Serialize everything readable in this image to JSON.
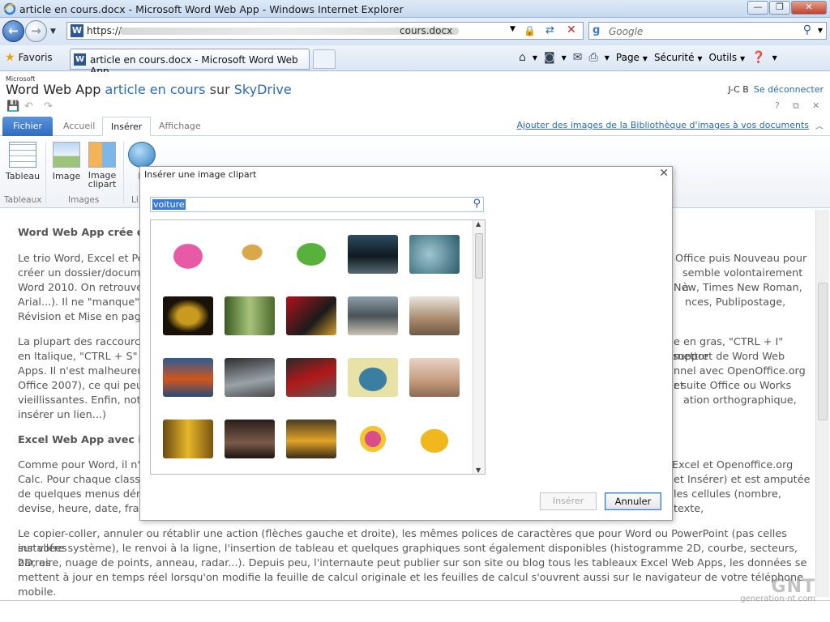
{
  "window": {
    "title": "article en cours.docx - Microsoft Word Web App - Windows Internet Explorer",
    "controls": [
      "—",
      "❐",
      "✕"
    ]
  },
  "address_bar": {
    "url_prefix": "https://",
    "url_suffix": "cours.docx",
    "search_placeholder": "Google"
  },
  "favorites_bar": {
    "favorites_label": "Favoris",
    "tab_title": "article en cours.docx - Microsoft Word Web App",
    "commands": [
      "Page",
      "Sécurité",
      "Outils"
    ]
  },
  "app_header": {
    "brand_small": "Microsoft",
    "app_name": "Word Web App",
    "doc_name": "article en cours",
    "sur": "sur",
    "service": "SkyDrive",
    "user": "J-C B",
    "signout": "Se déconnecter"
  },
  "ribbon_tabs": {
    "fichier": "Fichier",
    "accueil": "Accueil",
    "inserer": "Insérer",
    "affichage": "Affichage",
    "link": "Ajouter des images de la Bibliothèque d'images à vos documents"
  },
  "ribbon": {
    "tableau": "Tableau",
    "image": "Image",
    "clipart_l1": "Image",
    "clipart_l2": "clipart",
    "lien": "Li",
    "grp_tableaux": "Tableaux",
    "grp_images": "Images",
    "grp_liens": "Li"
  },
  "document": {
    "p1": "Word Web App crée des",
    "p2a": "Le trio Word, Excel et Po",
    "p2a_r": "Office puis Nouveau pour",
    "p2b": "créer un dossier/docume",
    "p2b_r": "semble volontairement à",
    "p2c": "Word 2010. On retrouve",
    "p2c_r": "New, Times New Roman,",
    "p2d": "Arial...). Il ne \"manque\"",
    "p2d_r": "nces, Publipostage,",
    "p2e": "Révision et Mise en page",
    "p3a": "La plupart des raccourcis",
    "p3a_r": "e en gras, \"CTRL + I\" mettre",
    "p3b": "en Italique, \"CTRL + S\" po",
    "p3b_r": "support de Word Web",
    "p3c": "Apps. Il n'est malheureu",
    "p3c_r": "nnel avec OpenOffice.org et",
    "p3d": "Office 2007), ce qui peut",
    "p3d_r": "r suite Office ou Works",
    "p3e": "vieillissantes. Enfin, note",
    "p3e_r": "ation orthographique,",
    "p3f": "insérer un lien...)",
    "p4": "Excel Web App avec inse",
    "p5a": "Comme pour Word, il n'y",
    "p5a_r": "Excel et Openoffice.org",
    "p5b": "Calc. Pour chaque classe",
    "p5b_r": "et Insérer) et est amputée",
    "p5c": "de quelques menus déro",
    "p5c_r": "les cellules (nombre, texte,",
    "p5d": "devise, heure, date, frac",
    "p6a": "Le copier-coller, annuler ou rétablir une action (flèches gauche et droite), les mêmes polices de caractères que pour Word ou PowerPoint (pas celles installées",
    "p6b": "sur votre système), le renvoi à la ligne, l'insertion de tableau et quelques graphiques sont également disponibles (histogramme 2D, courbe, secteurs, barres",
    "p6c": "2D, aire, nuage de points, anneau, radar...). Depuis peu, l'internaute peut publier sur son site ou blog tous les tableaux Excel Web Apps, les données se",
    "p6d": "mettent à jour en temps réel lorsqu'on modifie la feuille de calcul originale et les feuilles de calcul s'ouvrent aussi sur le navigateur de votre téléphone",
    "p6e": "mobile."
  },
  "dialog": {
    "title": "Insérer une image clipart",
    "search_value": "voiture",
    "btn_insert": "Insérer",
    "btn_cancel": "Annuler"
  },
  "watermark": {
    "logo": "GNT",
    "site": "generation-nt.com"
  }
}
